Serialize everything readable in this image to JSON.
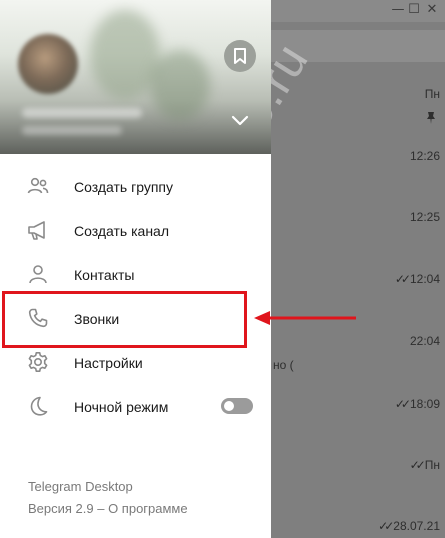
{
  "window": {
    "minimize_glyph": "—",
    "maximize_glyph": "☐",
    "close_glyph": "✕"
  },
  "drawer": {
    "menu": [
      {
        "id": "new-group",
        "label": "Создать группу",
        "icon": "group-icon"
      },
      {
        "id": "new-channel",
        "label": "Создать канал",
        "icon": "megaphone-icon"
      },
      {
        "id": "contacts",
        "label": "Контакты",
        "icon": "person-icon"
      },
      {
        "id": "calls",
        "label": "Звонки",
        "icon": "phone-icon"
      },
      {
        "id": "settings",
        "label": "Настройки",
        "icon": "gear-icon"
      },
      {
        "id": "night-mode",
        "label": "Ночной режим",
        "icon": "moon-icon",
        "toggle_on": false
      }
    ],
    "footer": {
      "app_name": "Telegram Desktop",
      "version_line": "Версия 2.9 – О программе"
    }
  },
  "chat_list": {
    "times": [
      {
        "text": "Пн",
        "read": false
      },
      {
        "text": "12:26",
        "read": false
      },
      {
        "text": "12:25",
        "read": false
      },
      {
        "text": "12:04",
        "read": true
      },
      {
        "text": "22:04",
        "read": false
      },
      {
        "text": "18:09",
        "read": true
      },
      {
        "text": "Пн",
        "read": true
      },
      {
        "text": "28.07.21",
        "read": true
      }
    ],
    "preview_fragment": "но ("
  },
  "watermark": "tgrage.ru",
  "colors": {
    "highlight": "#e0151c",
    "overlay": "#7f7f7f",
    "drawer_bg": "#ffffff"
  }
}
